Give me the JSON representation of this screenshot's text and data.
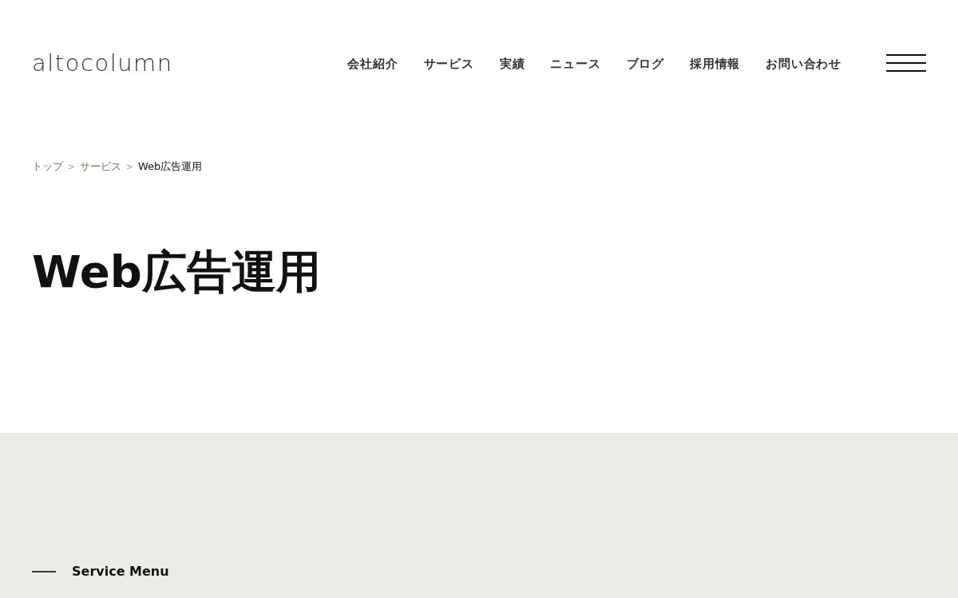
{
  "header": {
    "logo": "altocolumn",
    "nav": [
      "会社紹介",
      "サービス",
      "実績",
      "ニュース",
      "ブログ",
      "採用情報",
      "お問い合わせ"
    ]
  },
  "breadcrumb": [
    {
      "kind": "link",
      "label": "トップ"
    },
    {
      "kind": "separator",
      "label": "＞"
    },
    {
      "kind": "link",
      "label": "サービス"
    },
    {
      "kind": "separator",
      "label": "＞"
    },
    {
      "kind": "current",
      "label": "Web広告運用"
    }
  ],
  "page_title": "Web広告運用",
  "service_menu": {
    "heading": "Service Menu"
  }
}
